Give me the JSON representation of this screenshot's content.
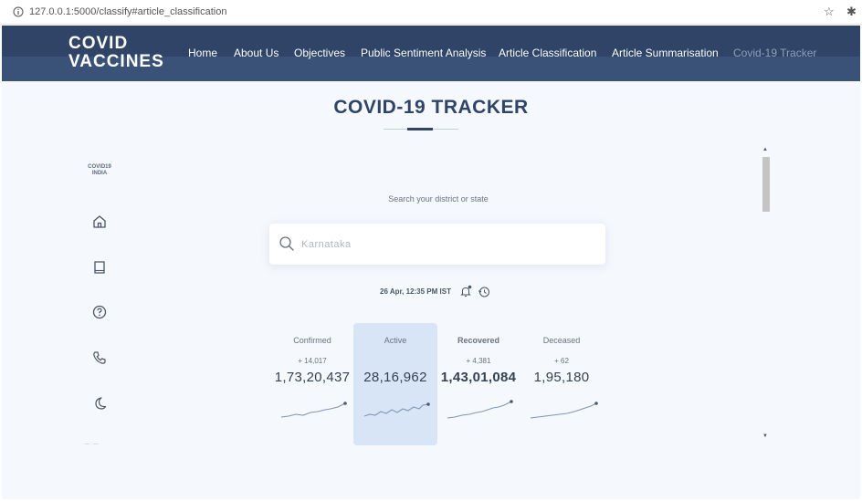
{
  "browser": {
    "url": "127.0.0.1:5000/classify#article_classification"
  },
  "header": {
    "logo_line1": "COVID",
    "logo_line2": "VACCINES",
    "nav": [
      {
        "label": "Home"
      },
      {
        "label": "About Us"
      },
      {
        "label": "Objectives"
      },
      {
        "label": "Public Sentiment Analysis"
      },
      {
        "label": "Article Classification"
      },
      {
        "label": "Article Summarisation"
      },
      {
        "label": "Covid-19 Tracker"
      }
    ]
  },
  "page": {
    "title": "COVID-19 TRACKER"
  },
  "sidebar": {
    "brand_line1": "COVID19",
    "brand_line2": "INDIA",
    "icons": [
      "home-icon",
      "book-icon",
      "help-icon",
      "phone-icon",
      "moon-icon"
    ]
  },
  "search": {
    "label": "Search your district or state",
    "placeholder": "Karnataka"
  },
  "timestamp": "26 Apr, 12:35 PM IST",
  "stats": [
    {
      "label": "Confirmed",
      "delta": "+ 14,017",
      "total": "1,73,20,437"
    },
    {
      "label": "Active",
      "delta": "",
      "total": "28,16,962"
    },
    {
      "label": "Recovered",
      "delta": "+ 4,381",
      "total": "1,43,01,084"
    },
    {
      "label": "Deceased",
      "delta": "+ 62",
      "total": "1,95,180"
    }
  ],
  "colors": {
    "navbar": "#2f4466",
    "navbar_band": "#3b5278",
    "background": "#f5f8fc",
    "active_card": "#d7e5f7",
    "sparkline": "#8496b5"
  }
}
